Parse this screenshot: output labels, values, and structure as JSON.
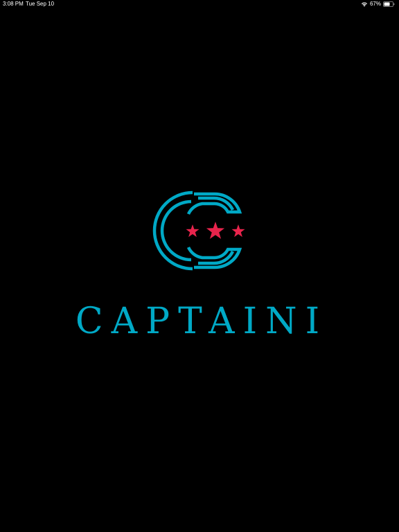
{
  "status_bar": {
    "time": "3:08 PM",
    "date": "Tue Sep 10",
    "battery_percent": "67%",
    "battery_level": 0.67,
    "icons": [
      "wifi-icon",
      "battery-icon"
    ]
  },
  "splash": {
    "brand_name": "CAPTAINI",
    "logo_icon": "captaini-logo-icon",
    "colors": {
      "background": "#000000",
      "brand": "#00a9c6",
      "stars": "#e8244c"
    }
  }
}
